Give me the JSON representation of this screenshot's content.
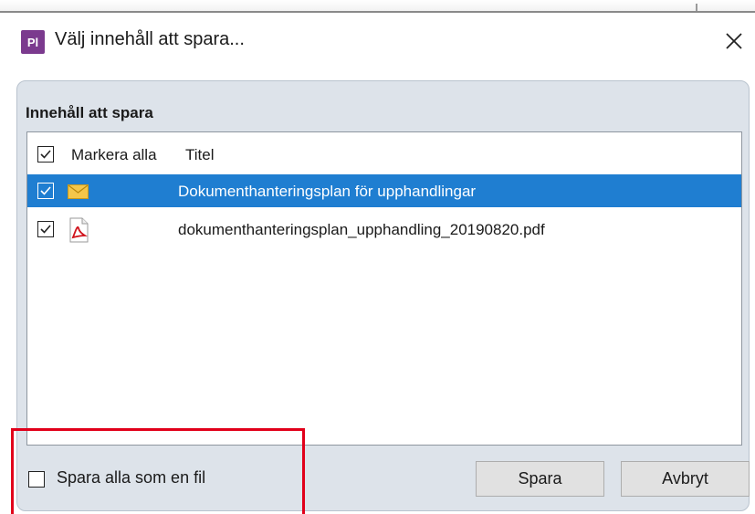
{
  "window": {
    "app_icon_text": "Pl",
    "title": "Välj innehåll att spara...",
    "close_icon": "close-icon"
  },
  "content": {
    "section_label": "Innehåll att spara",
    "header": {
      "select_all_label": "Markera alla",
      "select_all_checked": true,
      "column_title": "Titel"
    },
    "items": [
      {
        "title": "Dokumenthanteringsplan för upphandlingar",
        "icon": "mail-icon",
        "checked": true,
        "selected": true
      },
      {
        "title": "dokumenthanteringsplan_upphandling_20190820.pdf",
        "icon": "pdf-icon",
        "checked": true,
        "selected": false
      }
    ]
  },
  "footer": {
    "save_as_one_file_label": "Spara alla som en fil",
    "save_as_one_file_checked": false,
    "save_button": "Spara",
    "cancel_button": "Avbryt"
  },
  "colors": {
    "selection": "#1f7ed1",
    "annotation": "#e1001a",
    "app_icon": "#7b3a8e"
  }
}
